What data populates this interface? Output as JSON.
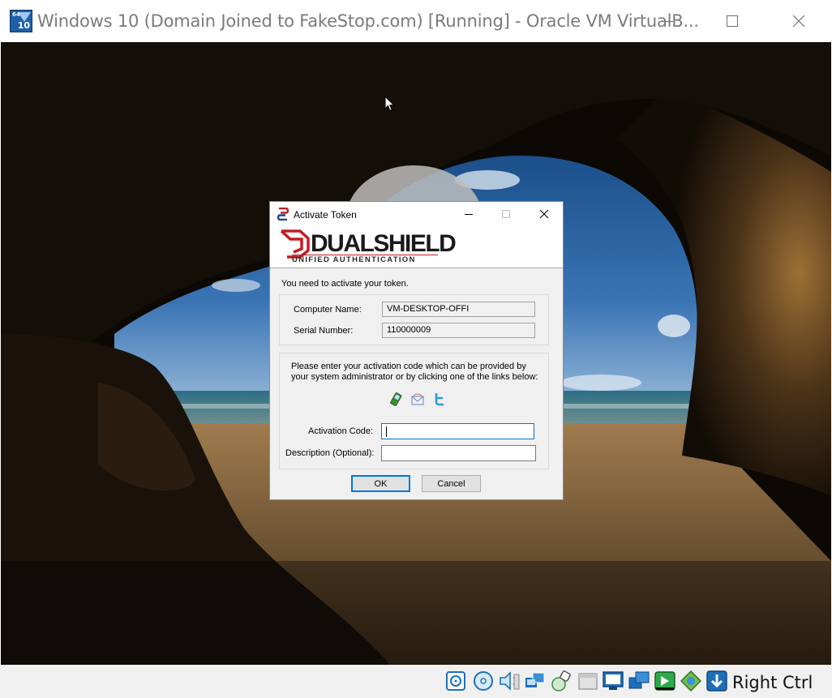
{
  "window": {
    "title": "Windows 10 (Domain Joined to FakeStop.com) [Running] - Oracle VM VirtualB...",
    "app_icon_badge_top": "64",
    "app_icon_badge_bottom": "10"
  },
  "dialog": {
    "title": "Activate Token",
    "brand": "DUALSHIELD",
    "brand_sub": "UNIFIED AUTHENTICATION",
    "message": "You need to activate your token.",
    "computer_name_label": "Computer Name:",
    "computer_name_value": "VM-DESKTOP-OFFI",
    "serial_number_label": "Serial Number:",
    "serial_number_value": "110000009",
    "instructions": "Please enter your activation code which can be provided by your system administrator or by clicking one of the links below:",
    "link_icons": [
      "sms-link-icon",
      "email-link-icon",
      "twitter-link-icon"
    ],
    "activation_code_label": "Activation Code:",
    "activation_code_value": "",
    "description_label": "Description (Optional):",
    "description_value": "",
    "ok_label": "OK",
    "cancel_label": "Cancel"
  },
  "statusbar": {
    "icons": [
      "hard-disk-icon",
      "optical-drive-icon",
      "audio-icon",
      "network-icon",
      "usb-icon",
      "shared-folders-icon",
      "display-icon",
      "video-capture-icon",
      "recording-icon",
      "mouse-integration-icon",
      "keyboard-capture-icon"
    ],
    "host_key": "Right Ctrl"
  },
  "colors": {
    "brand_red": "#c21d24",
    "focus_blue": "#0078d7",
    "vbox_blue": "#1e5fa8"
  }
}
